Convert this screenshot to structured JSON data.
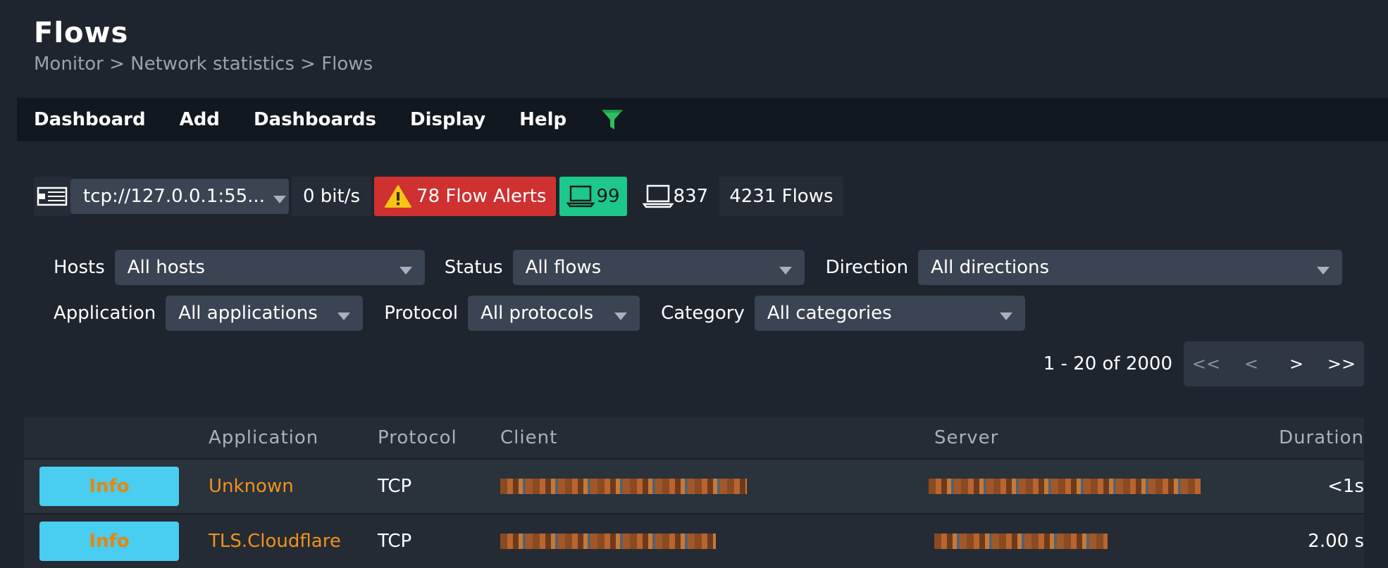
{
  "page": {
    "title": "Flows",
    "breadcrumb": [
      "Monitor",
      ">",
      "Network statistics",
      ">",
      "Flows"
    ]
  },
  "menu": {
    "items": [
      "Dashboard",
      "Add",
      "Dashboards",
      "Display",
      "Help"
    ],
    "filter_icon_color": "#2bc15f"
  },
  "stats": {
    "interface": "tcp://127.0.0.1:55...",
    "throughput": "0 bit/s",
    "alerts": "78 Flow Alerts",
    "active_hosts": "99",
    "hosts": "837",
    "flows": "4231 Flows"
  },
  "filters": {
    "hosts_label": "Hosts",
    "hosts_value": "All hosts",
    "status_label": "Status",
    "status_value": "All flows",
    "direction_label": "Direction",
    "direction_value": "All directions",
    "application_label": "Application",
    "application_value": "All applications",
    "protocol_label": "Protocol",
    "protocol_value": "All protocols",
    "category_label": "Category",
    "category_value": "All categories"
  },
  "pagination": {
    "info": "1 - 20 of 2000",
    "first": "<<",
    "prev": "<",
    "next": ">",
    "last": ">>"
  },
  "table": {
    "headers": {
      "application": "Application",
      "protocol": "Protocol",
      "client": "Client",
      "server": "Server",
      "duration": "Duration"
    },
    "rows": [
      {
        "info": "Info",
        "application": "Unknown",
        "protocol": "TCP",
        "duration": "<1s"
      },
      {
        "info": "Info",
        "application": "TLS.Cloudflare",
        "protocol": "TCP",
        "duration": "2.00 s"
      }
    ]
  },
  "colors": {
    "background": "#1e252e",
    "menubar": "#121820",
    "alert": "#cf3131",
    "green": "#1ec78a",
    "info_button": "#49cdf0",
    "link_orange": "#f0921c"
  }
}
